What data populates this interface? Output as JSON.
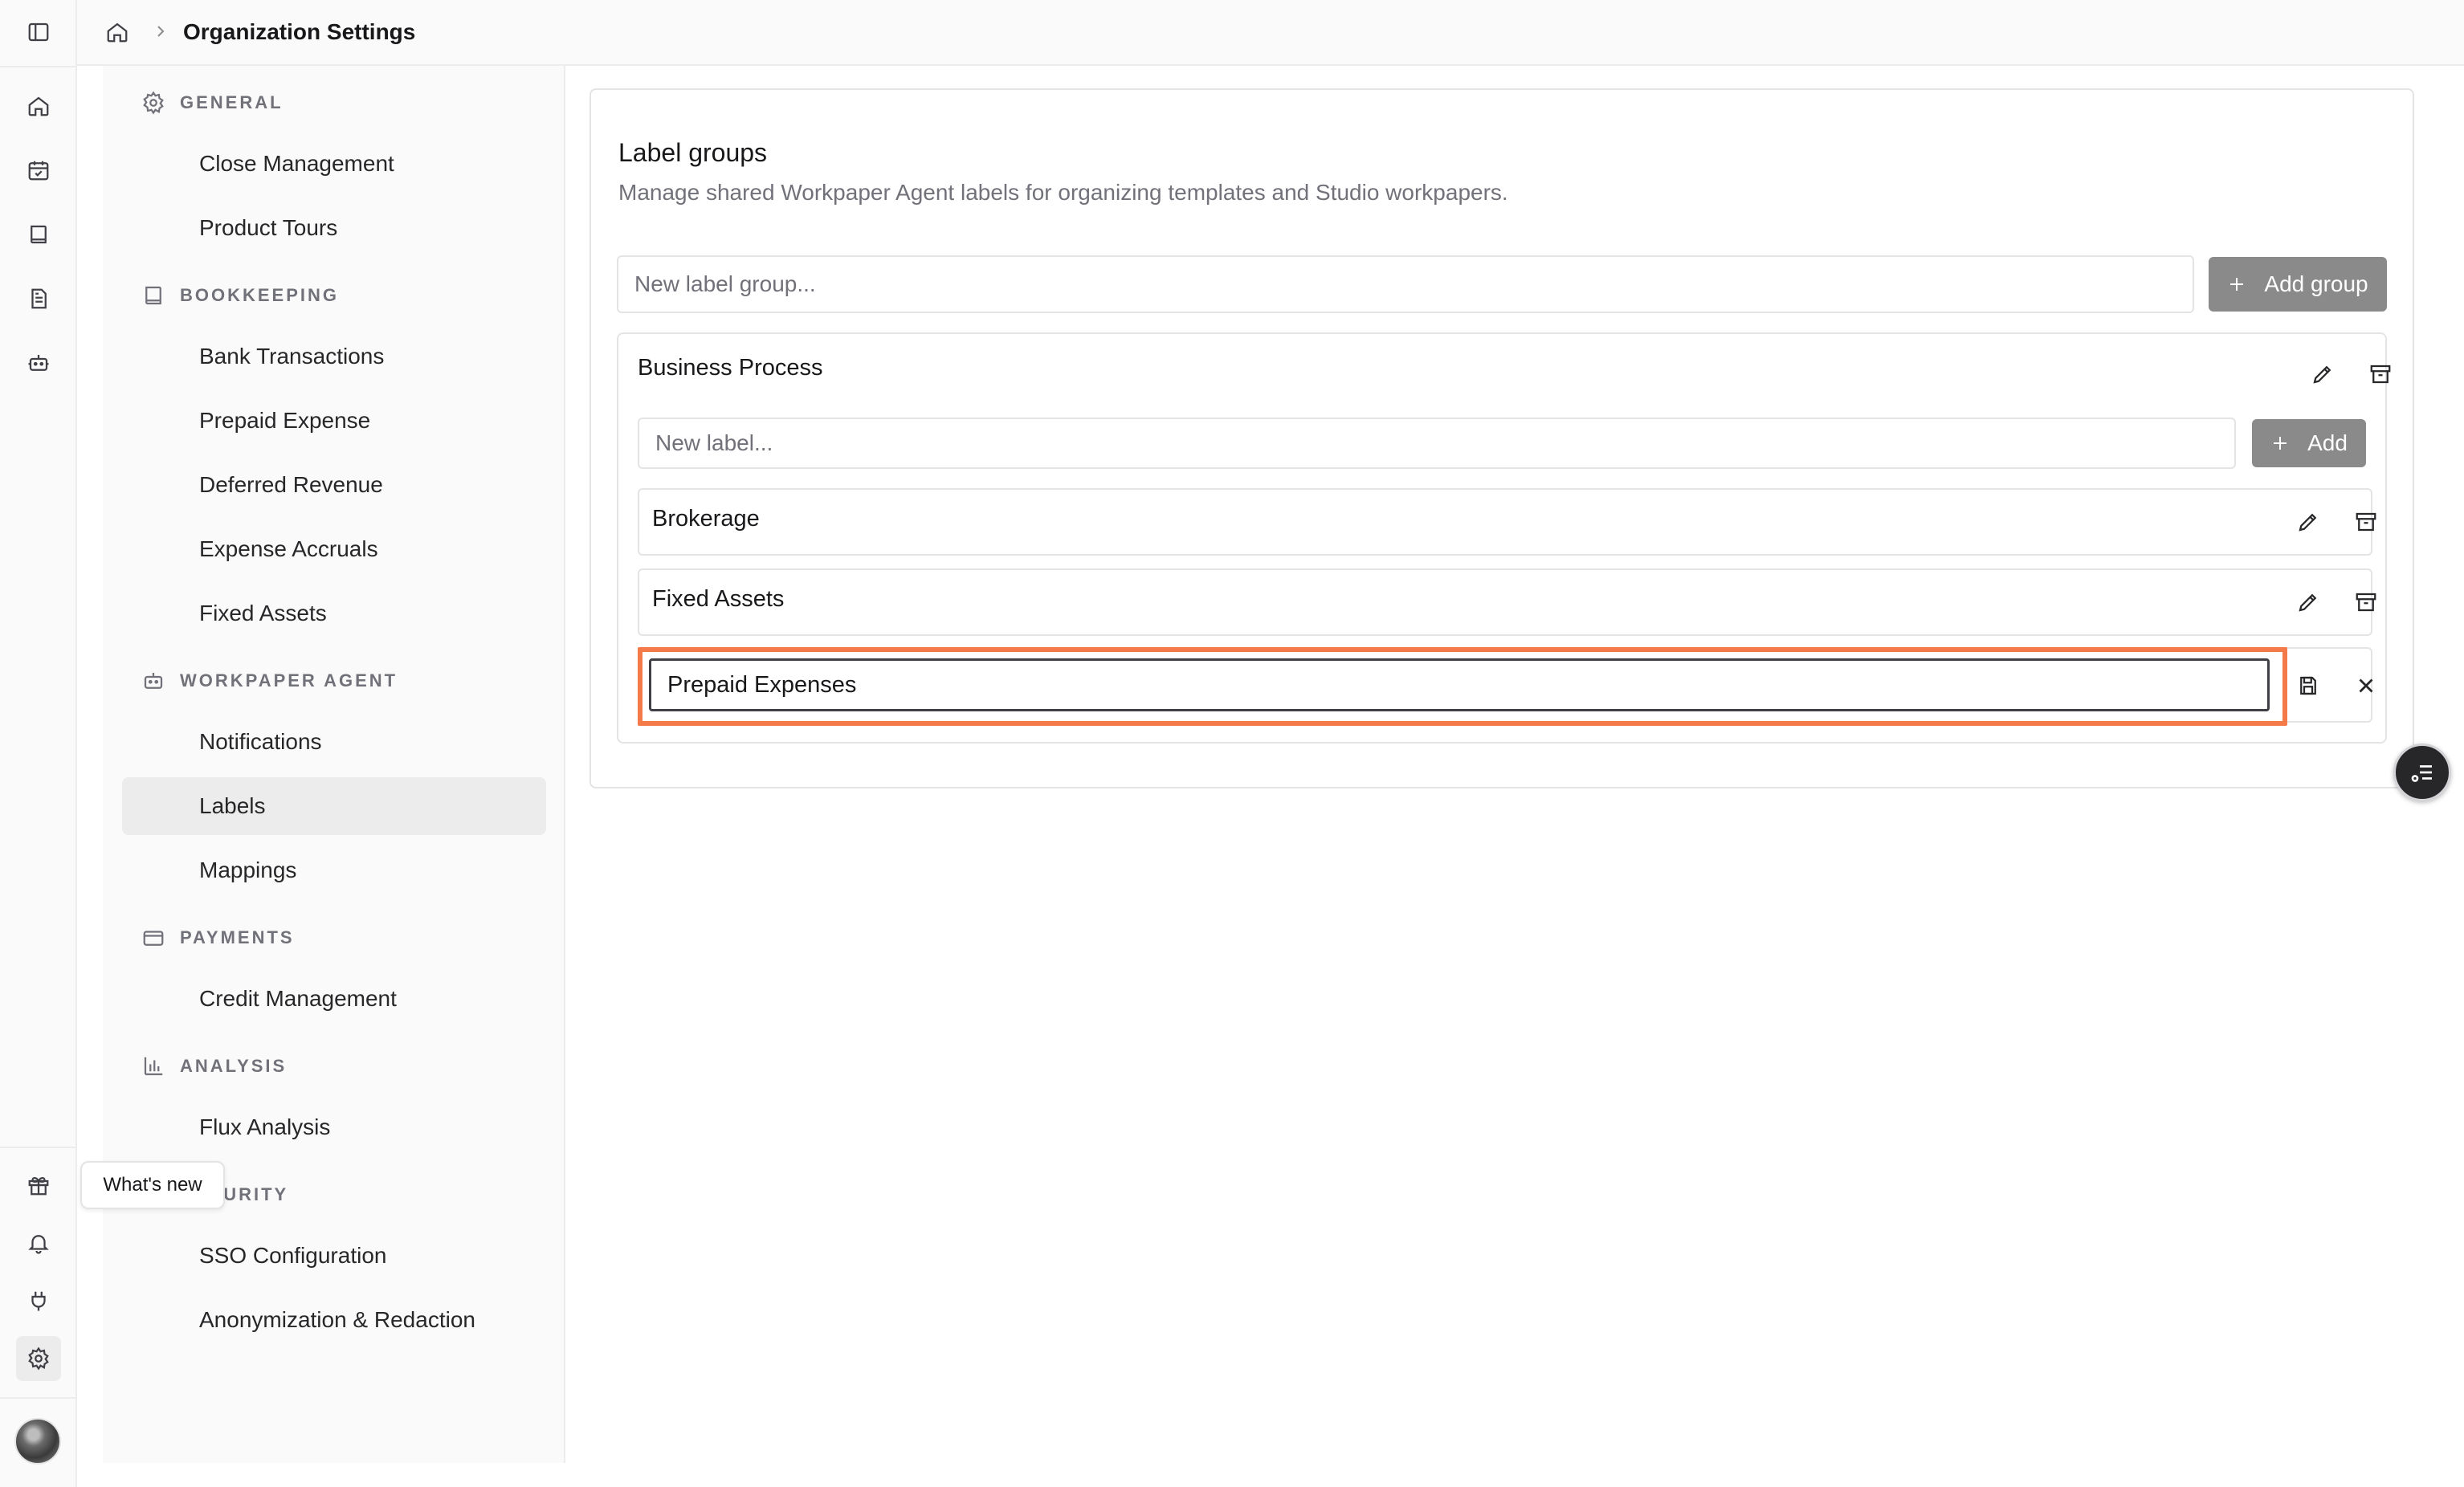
{
  "rail": {
    "top_icons": [
      "sidebar-toggle-icon",
      "home-icon",
      "calendar-check-icon",
      "book-icon",
      "document-icon",
      "bot-icon"
    ],
    "bottom_icons": [
      "gift-icon",
      "bell-icon",
      "plug-icon",
      "gear-icon"
    ],
    "tooltip": "What's new"
  },
  "header": {
    "breadcrumb_home_icon": "home-icon",
    "breadcrumb_current": "Organization Settings"
  },
  "sidebar": {
    "sections": [
      {
        "title": "GENERAL",
        "icon": "gear-icon",
        "items": [
          "Close Management",
          "Product Tours"
        ]
      },
      {
        "title": "BOOKKEEPING",
        "icon": "book-icon",
        "items": [
          "Bank Transactions",
          "Prepaid Expense",
          "Deferred Revenue",
          "Expense Accruals",
          "Fixed Assets"
        ]
      },
      {
        "title": "WORKPAPER AGENT",
        "icon": "bot-icon",
        "items": [
          "Notifications",
          "Labels",
          "Mappings"
        ]
      },
      {
        "title": "PAYMENTS",
        "icon": "credit-card-icon",
        "items": [
          "Credit Management"
        ]
      },
      {
        "title": "ANALYSIS",
        "icon": "bar-chart-icon",
        "items": [
          "Flux Analysis"
        ]
      },
      {
        "title": "SECURITY",
        "icon": "shield-icon",
        "items": [
          "SSO Configuration",
          "Anonymization & Redaction"
        ]
      }
    ],
    "active_item": "Labels"
  },
  "main": {
    "title": "Label groups",
    "subtitle": "Manage shared Workpaper Agent labels for organizing templates and Studio workpapers.",
    "new_group_placeholder": "New label group...",
    "add_group_label": "Add group",
    "group": {
      "name": "Business Process",
      "new_label_placeholder": "New label...",
      "add_label": "Add",
      "labels": [
        "Brokerage",
        "Fixed Assets"
      ],
      "editing_value": "Prepaid Expenses"
    }
  },
  "colors": {
    "highlight": "#f47a4a",
    "button_gray": "#8a8a8a",
    "active_nav": "#ececec"
  }
}
